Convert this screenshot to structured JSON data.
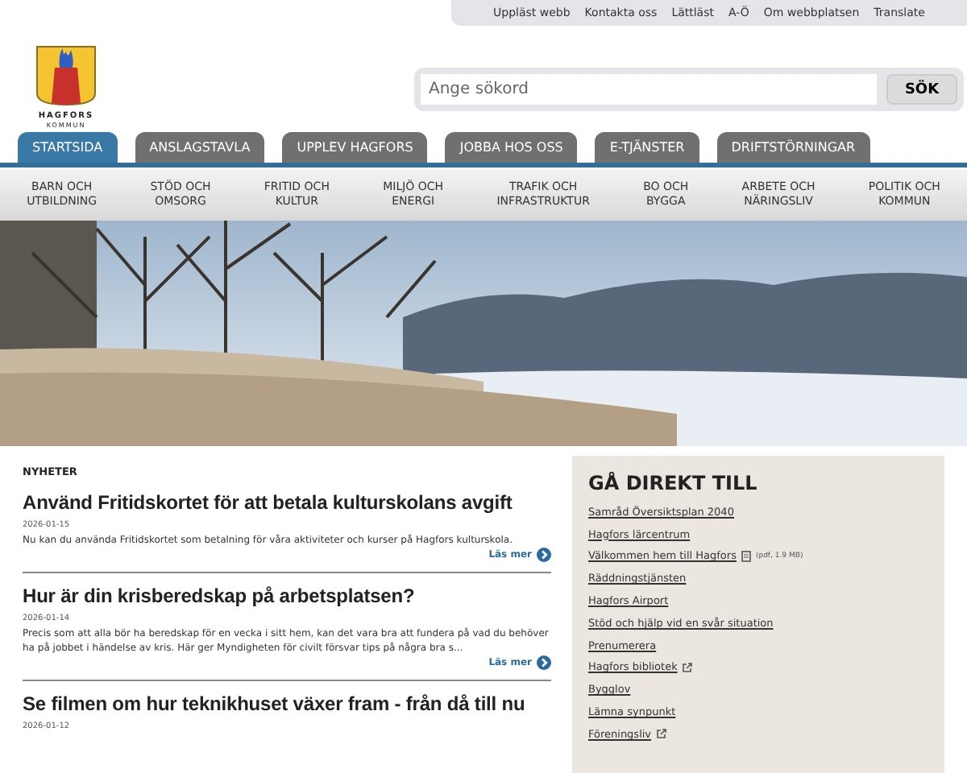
{
  "utility_links": [
    "Uppläst webb",
    "Kontakta oss",
    "Lättläst",
    "A-Ö",
    "Om webbplatsen",
    "Translate"
  ],
  "logo": {
    "name": "HAGFORS",
    "subtitle": "KOMMUN"
  },
  "search": {
    "placeholder": "Ange sökord",
    "button": "SÖK"
  },
  "tabs": [
    {
      "label": "STARTSIDA",
      "selected": true
    },
    {
      "label": "ANSLAGSTAVLA",
      "selected": false
    },
    {
      "label": "UPPLEV HAGFORS",
      "selected": false
    },
    {
      "label": "JOBBA HOS OSS",
      "selected": false
    },
    {
      "label": "E-TJÄNSTER",
      "selected": false
    },
    {
      "label": "DRIFTSTÖRNINGAR",
      "selected": false
    }
  ],
  "categories": [
    [
      "BARN OCH",
      "UTBILDNING"
    ],
    [
      "STÖD OCH",
      "OMSORG"
    ],
    [
      "FRITID OCH",
      "KULTUR"
    ],
    [
      "MILJÖ OCH",
      "ENERGI"
    ],
    [
      "TRAFIK OCH",
      "INFRASTRUKTUR"
    ],
    [
      "BO OCH",
      "BYGGA"
    ],
    [
      "ARBETE OCH",
      "NÄRINGSLIV"
    ],
    [
      "POLITIK OCH",
      "KOMMUN"
    ]
  ],
  "news": {
    "heading": "NYHETER",
    "items": [
      {
        "title": "Använd Fritidskortet för att betala kulturskolans avgift",
        "date": "2026-01-15",
        "summary": "Nu kan du använda Fritidskortet som betalning för våra aktiviteter och kurser på Hagfors kulturskola.",
        "more": "Läs mer"
      },
      {
        "title": "Hur är din krisberedskap på arbetsplatsen?",
        "date": "2026-01-14",
        "summary": "Precis som att alla bör ha beredskap för en vecka i sitt hem, kan det vara bra att fundera på vad du behöver ha på jobbet i händelse av kris. Här ger Myndigheten för civilt försvar tips på några bra s...",
        "more": "Läs mer"
      },
      {
        "title": "Se filmen om hur teknikhuset växer fram - från då till nu",
        "date": "2026-01-12"
      }
    ]
  },
  "quick_links": {
    "heading": "GÅ DIREKT TILL",
    "items": [
      {
        "label": "Samråd Översiktsplan 2040",
        "kind": "link"
      },
      {
        "label": "Hagfors lärcentrum",
        "kind": "link"
      },
      {
        "label": "Välkommen hem till Hagfors",
        "kind": "pdf",
        "note": "(pdf, 1.9 MB)"
      },
      {
        "label": "Räddningstjänsten",
        "kind": "link"
      },
      {
        "label": "Hagfors Airport",
        "kind": "link"
      },
      {
        "label": "Stöd och hjälp vid en svår situation",
        "kind": "link"
      },
      {
        "label": "Prenumerera",
        "kind": "link"
      },
      {
        "label": "Hagfors bibliotek",
        "kind": "external"
      },
      {
        "label": "Bygglov",
        "kind": "link"
      },
      {
        "label": "Lämna synpunkt",
        "kind": "link"
      },
      {
        "label": "Föreningsliv",
        "kind": "external"
      }
    ]
  }
}
